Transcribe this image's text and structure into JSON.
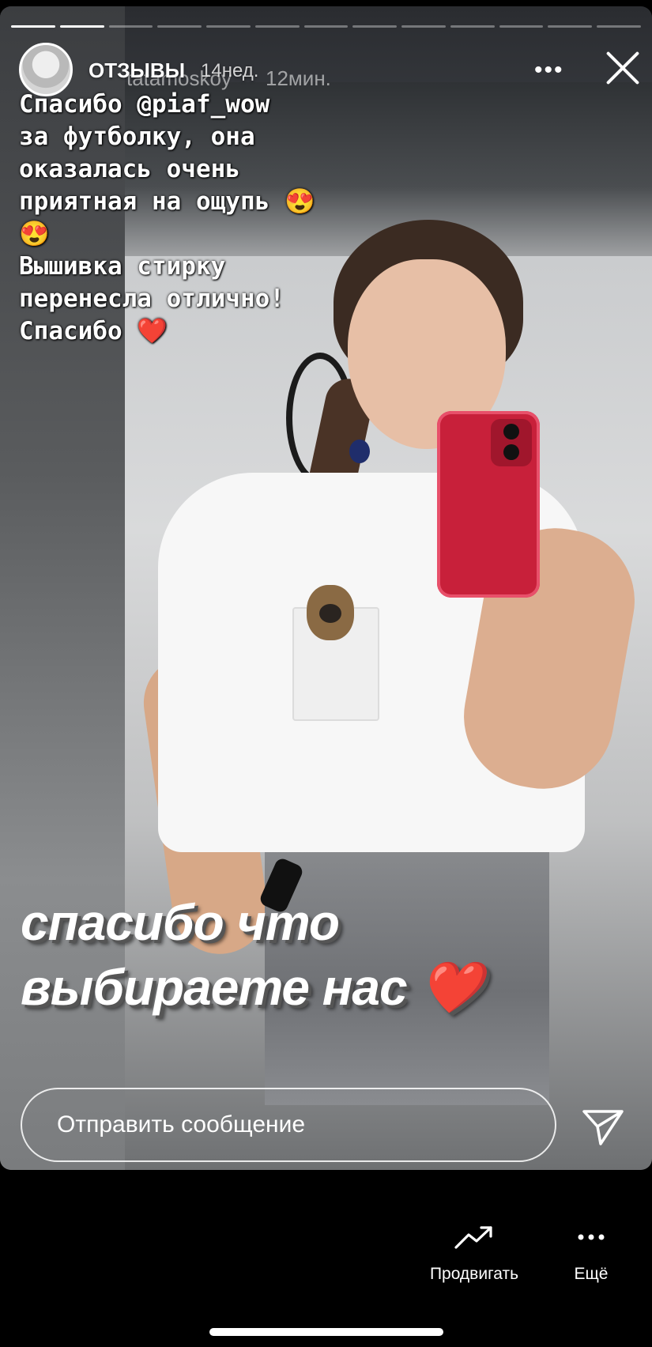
{
  "story": {
    "progress_segments": 13,
    "progress_completed": 2,
    "account_name": "ОТЗЫВЫ",
    "posted_time": "14нед.",
    "original_author": "tatamoskoy",
    "original_time": "12мин.",
    "more_icon": "more-dots-icon",
    "close_icon": "close-icon"
  },
  "caption": {
    "lines": [
      "Спасибо @piaf_wow",
      "за футболку, она",
      "оказалась очень",
      "приятная на ощупь 😍",
      "😍",
      "Вышивка стирку",
      "перенесла отлично!",
      "Спасибо ❤️"
    ]
  },
  "overlay_text": {
    "line1": "спасибо что",
    "line2": "выбираете нас ❤️"
  },
  "reply": {
    "placeholder": "Отправить сообщение",
    "send_icon": "paper-plane-icon"
  },
  "actions": {
    "promote_label": "Продвигать",
    "promote_icon": "trending-up-icon",
    "more_label": "Ещё",
    "more_icon": "more-dots-icon"
  }
}
